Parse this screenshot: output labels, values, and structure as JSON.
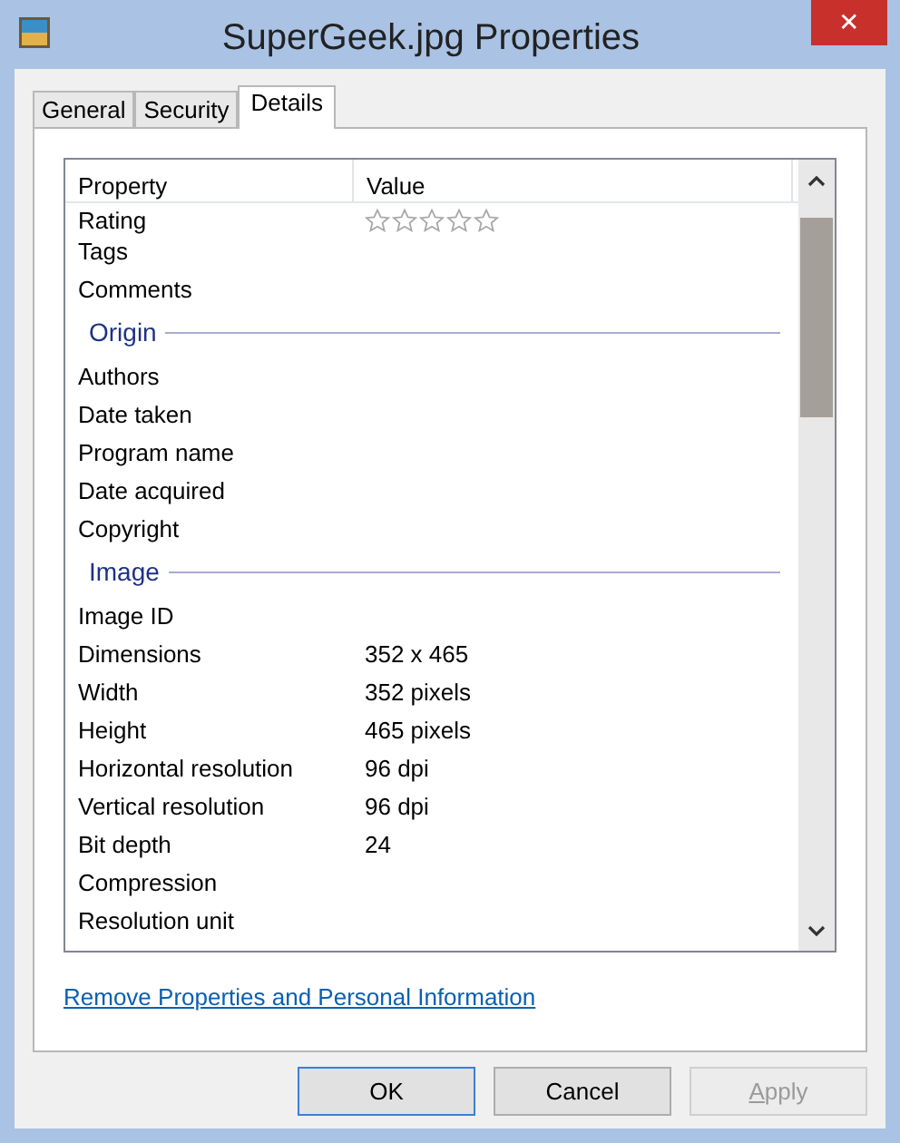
{
  "window": {
    "title": "SuperGeek.jpg Properties",
    "close": "✕"
  },
  "tabs": [
    {
      "label": "General",
      "selected": false
    },
    {
      "label": "Security",
      "selected": false
    },
    {
      "label": "Details",
      "selected": true
    }
  ],
  "table": {
    "columns": [
      "Property",
      "Value"
    ],
    "rows": [
      {
        "kind": "row",
        "name": "Rating",
        "stars": 0
      },
      {
        "kind": "row",
        "name": "Tags"
      },
      {
        "kind": "row",
        "name": "Comments"
      },
      {
        "kind": "group",
        "name": "Origin"
      },
      {
        "kind": "row",
        "name": "Authors"
      },
      {
        "kind": "row",
        "name": "Date taken"
      },
      {
        "kind": "row",
        "name": "Program name"
      },
      {
        "kind": "row",
        "name": "Date acquired"
      },
      {
        "kind": "row",
        "name": "Copyright"
      },
      {
        "kind": "group",
        "name": "Image"
      },
      {
        "kind": "row",
        "name": "Image ID"
      },
      {
        "kind": "row",
        "name": "Dimensions",
        "value": "352 x 465"
      },
      {
        "kind": "row",
        "name": "Width",
        "value": "352 pixels"
      },
      {
        "kind": "row",
        "name": "Height",
        "value": "465 pixels"
      },
      {
        "kind": "row",
        "name": "Horizontal resolution",
        "value": "96 dpi"
      },
      {
        "kind": "row",
        "name": "Vertical resolution",
        "value": "96 dpi"
      },
      {
        "kind": "row",
        "name": "Bit depth",
        "value": "24"
      },
      {
        "kind": "row",
        "name": "Compression"
      },
      {
        "kind": "row",
        "name": "Resolution unit"
      }
    ]
  },
  "link": "Remove Properties and Personal Information",
  "buttons": [
    {
      "label": "OK",
      "default": true,
      "disabled": false,
      "access_key": false
    },
    {
      "label": "Cancel",
      "default": false,
      "disabled": false,
      "access_key": false
    },
    {
      "label": "Apply",
      "default": false,
      "disabled": true,
      "access_key": true
    }
  ]
}
